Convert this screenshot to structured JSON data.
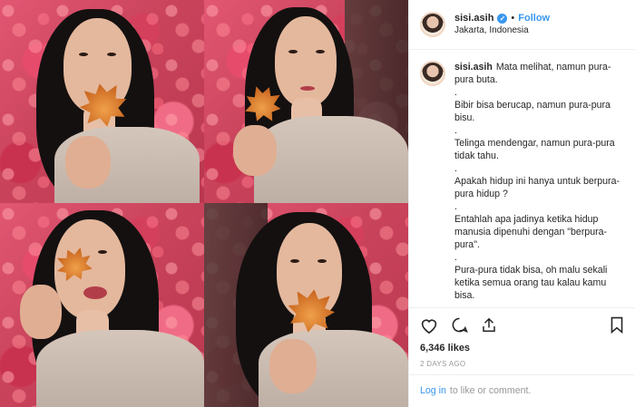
{
  "post": {
    "username": "sisi.asih",
    "follow_label": "Follow",
    "separator": "•",
    "location": "Jakarta, Indonesia",
    "caption_first": "Mata melihat, namun pura-pura buta.",
    "caption_lines": [
      ".",
      "Bibir bisa berucap, namun pura-pura bisu.",
      ".",
      "Telinga mendengar, namun pura-pura tidak tahu.",
      ".",
      "Apakah hidup ini hanya untuk berpura-pura hidup ?",
      ".",
      "Entahlah apa jadinya ketika hidup manusia dipenuhi dengan \"berpura-pura\".",
      ".",
      "Pura-pura tidak bisa, oh malu sekali ketika semua orang tau kalau kamu bisa.",
      "."
    ],
    "likes": "6,346 likes",
    "date": "2 DAYS AGO",
    "login_link": "Log in",
    "login_rest": "to like or comment."
  },
  "icons": {
    "like": "heart-icon",
    "comment": "comment-icon",
    "share": "share-icon",
    "save": "bookmark-icon",
    "verified": "verified-badge-icon"
  },
  "colors": {
    "accent": "#3897f0",
    "muted": "#999999",
    "border": "#efefef"
  }
}
